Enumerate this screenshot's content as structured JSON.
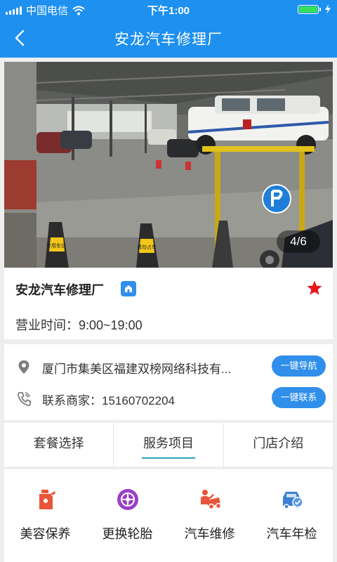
{
  "status_bar": {
    "carrier": "中国电信",
    "time": "下午1:00",
    "battery_level": 1.0,
    "icons": [
      "signal-icon",
      "wifi-icon",
      "battery-icon",
      "charging-icon"
    ]
  },
  "nav": {
    "title": "安龙汽车修理厂",
    "back_icon": "back-arrow-icon"
  },
  "photo": {
    "counter": "4/6",
    "current": 4,
    "total": 6,
    "sign_left": "专用车位",
    "sign_right": "请勿占车"
  },
  "shop": {
    "name": "安龙汽车修理厂",
    "hours_label": "营业时间：",
    "hours_value": "9:00~19:00",
    "favorite_icon": "star-icon",
    "favorite_color": "#e8171d"
  },
  "contact": {
    "address": "厦门市集美区福建双榜网络科技有...",
    "navigate_button": "一键导航",
    "phone_label": "联系商家：",
    "phone": "15160702204",
    "call_button": "一键联系"
  },
  "tabs": [
    {
      "label": "套餐选择",
      "active": false
    },
    {
      "label": "服务项目",
      "active": true
    },
    {
      "label": "门店介绍",
      "active": false
    }
  ],
  "services": [
    {
      "label": "美容保养",
      "icon": "oil-can-icon",
      "color": "#e8553a"
    },
    {
      "label": "更换轮胎",
      "icon": "tire-icon",
      "color": "#9b3ec9"
    },
    {
      "label": "汽车维修",
      "icon": "repair-icon",
      "color": "#e8553a"
    },
    {
      "label": "汽车年检",
      "icon": "inspection-car-icon",
      "color": "#3b7fd6"
    }
  ],
  "colors": {
    "primary": "#1e90f0",
    "button": "#2f8fea",
    "tab_underline": "#2aa8b8"
  }
}
